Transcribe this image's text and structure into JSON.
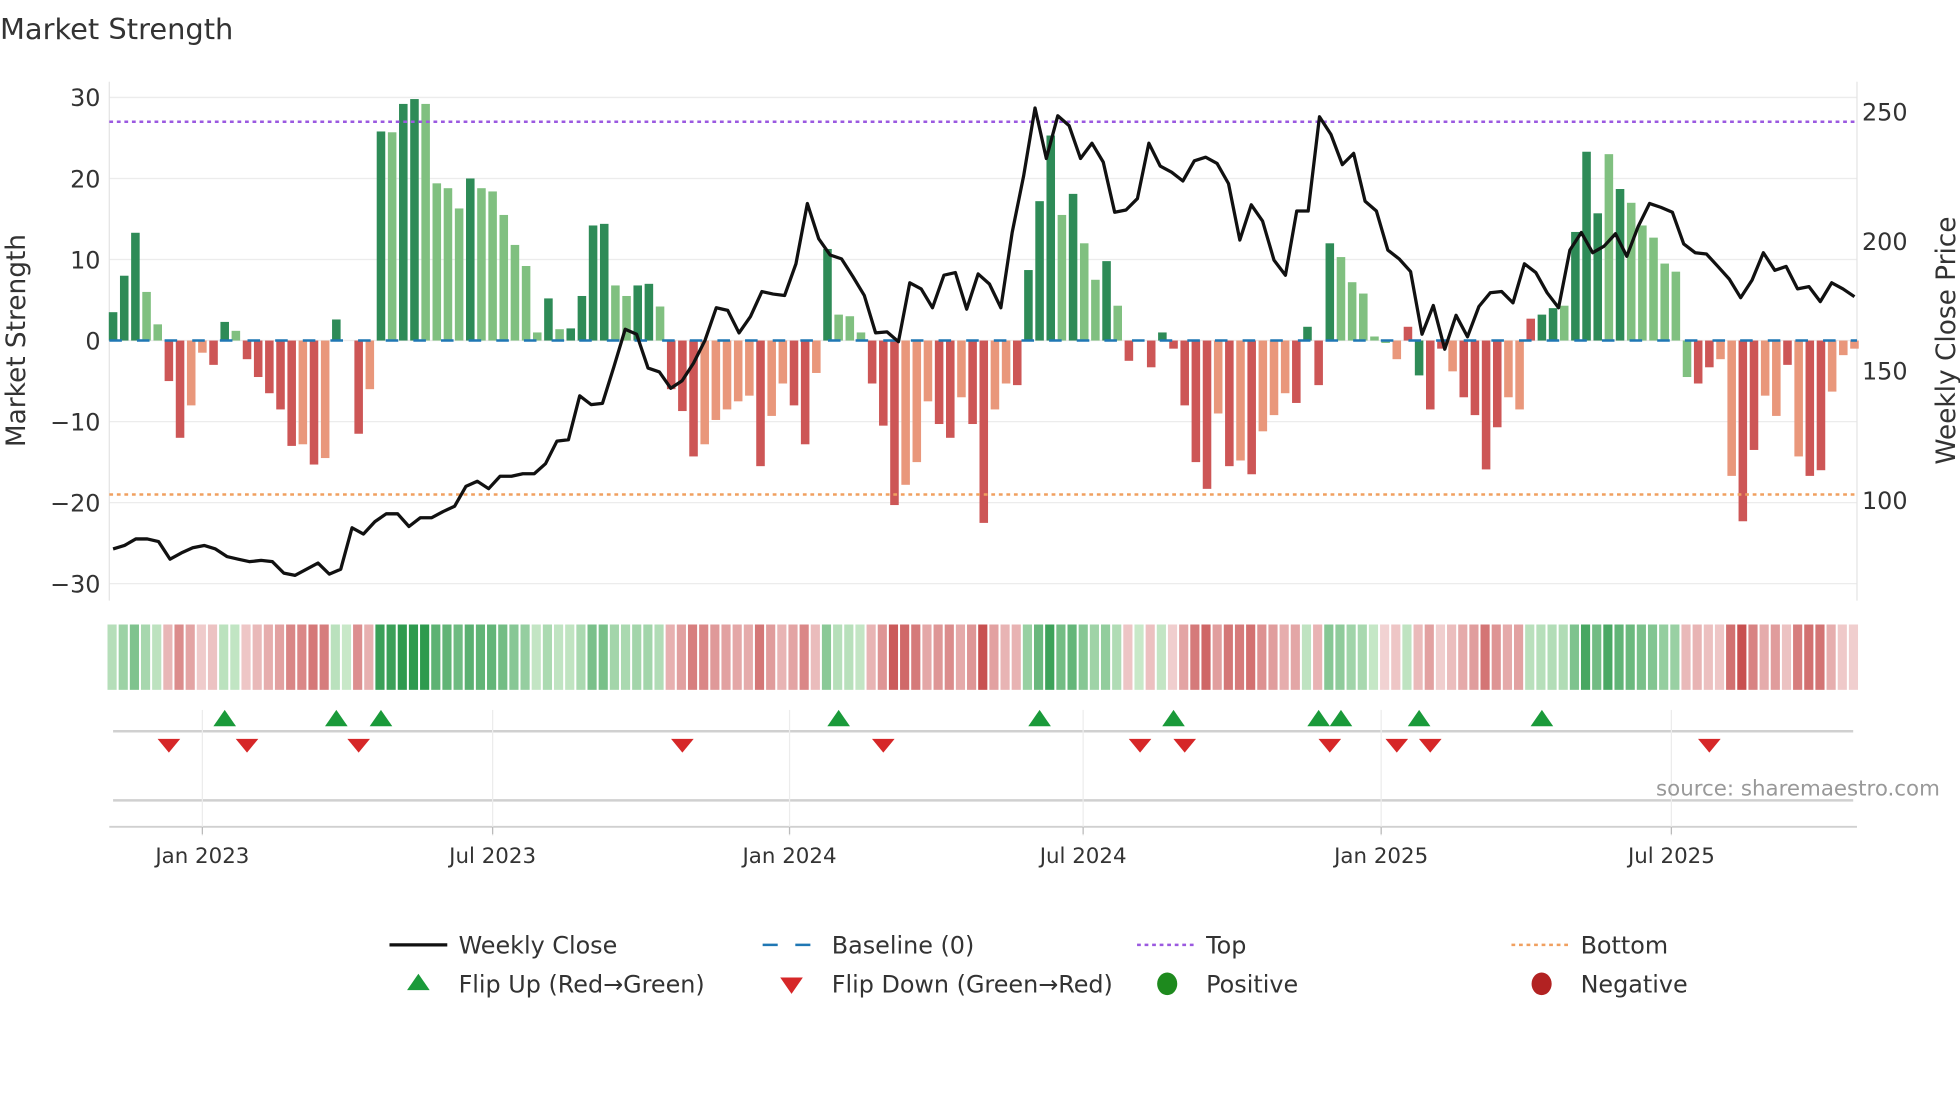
{
  "title": "Market Strength",
  "source": "source: sharemaestro.com",
  "chart_data": {
    "type": "bar",
    "title": "Market Strength",
    "ylabel": "Market Strength",
    "y2label": "Weekly Close Price",
    "ylim": [
      -32,
      32
    ],
    "y2lim": [
      65,
      260
    ],
    "yticks": [
      30,
      20,
      10,
      0,
      -10,
      -20,
      -30
    ],
    "ytick_labels": [
      "30",
      "20",
      "10",
      "0",
      "−10",
      "−20",
      "−30"
    ],
    "y2ticks": [
      250,
      200,
      150,
      100
    ],
    "y2tick_labels": [
      "250",
      "200",
      "150",
      "100"
    ],
    "x_unit": "week index",
    "xticks": [
      {
        "week": 8,
        "label": "Jan 2023"
      },
      {
        "week": 34,
        "label": "Jul 2023"
      },
      {
        "week": 60.6,
        "label": "Jan 2024"
      },
      {
        "week": 86.9,
        "label": "Jul 2024"
      },
      {
        "week": 113.6,
        "label": "Jan 2025"
      },
      {
        "week": 139.6,
        "label": "Jul 2025"
      }
    ],
    "top_level": 27,
    "bottom_level": -19,
    "baseline": 0,
    "strength": [
      3.5,
      8,
      13.3,
      6,
      2,
      -5,
      -12,
      -8,
      -1.5,
      -3,
      2.3,
      1.2,
      -2.3,
      -4.5,
      -6.5,
      -8.5,
      -13,
      -12.8,
      -15.3,
      -14.5,
      2.6,
      0,
      -11.5,
      -6,
      25.8,
      25.7,
      29.2,
      29.8,
      29.2,
      19.4,
      18.8,
      16.3,
      20,
      18.8,
      18.4,
      15.5,
      11.8,
      9.2,
      1,
      5.2,
      1.4,
      1.5,
      5.5,
      14.2,
      14.4,
      6.8,
      5.5,
      6.8,
      7,
      4.2,
      -6,
      -8.7,
      -14.3,
      -12.8,
      -9.8,
      -8.5,
      -7.5,
      -6.8,
      -15.5,
      -9.3,
      -5.3,
      -8,
      -12.8,
      -4,
      11.3,
      3.2,
      3,
      1,
      -5.3,
      -10.5,
      -20.3,
      -17.8,
      -15,
      -7.5,
      -10.3,
      -12,
      -7,
      -10.3,
      -22.5,
      -8.5,
      -5.3,
      -5.5,
      8.7,
      17.2,
      25.3,
      15.5,
      18.1,
      12,
      7.5,
      9.8,
      4.3,
      -2.5,
      0,
      -3.3,
      1,
      -1,
      -8,
      -15,
      -18.3,
      -9,
      -15.5,
      -14.8,
      -16.5,
      -11.2,
      -9.2,
      -6.5,
      -7.7,
      1.7,
      -5.5,
      12,
      10.3,
      7.2,
      5.8,
      0.5,
      -0.3,
      -2.3,
      1.7,
      -4.3,
      -8.5,
      -1,
      -3.8,
      -7,
      -9.2,
      -15.9,
      -10.7,
      -7,
      -8.5,
      2.7,
      3.2,
      4,
      4.3,
      13.4,
      23.3,
      15.7,
      23,
      18.7,
      17,
      14.2,
      12.7,
      9.5,
      8.5,
      -4.5,
      -5.3,
      -3.3,
      -2.3,
      -16.7,
      -22.3,
      -13.5,
      -6.8,
      -9.3,
      -3,
      -14.3,
      -16.7,
      -16,
      -6.3,
      -1.8,
      -1
    ],
    "shade": "GGGggRRrrRGgRRRRRrRrGGRrGgGGggggGggggggGgGGGGggGGgRRRrrrrrRrrRRrGgggRRRrrrRRrRRrrRGGGgGggGgRGRGRRRRrRrRrrrRGRGgggggrRGRRrRRRRrrRGGgGGGgGggggggRRrrRRrrRrRRrrrr",
    "weekly_close": [
      81.1,
      82.5,
      85,
      85,
      84,
      77.2,
      79.6,
      81.6,
      82.5,
      81.1,
      78.2,
      77.2,
      76.2,
      76.7,
      76.2,
      71.8,
      70.9,
      73.3,
      75.7,
      71.4,
      73.3,
      89.3,
      86.9,
      91.7,
      94.7,
      94.7,
      89.8,
      93.2,
      93.2,
      95.6,
      97.6,
      105.3,
      107.3,
      104.4,
      109.2,
      109.2,
      110.2,
      110.2,
      114.1,
      122.8,
      123.3,
      140.3,
      136.9,
      137.4,
      151.5,
      166,
      164.1,
      151,
      149.5,
      143.2,
      146.1,
      152.9,
      161.7,
      174.3,
      173.3,
      164.6,
      170.9,
      180.6,
      179.6,
      179.1,
      191.3,
      214.6,
      201,
      194.7,
      193.2,
      186.4,
      179.1,
      164.6,
      165,
      161.2,
      184,
      181.6,
      174.3,
      186.9,
      187.9,
      173.8,
      187.4,
      183.5,
      174.3,
      203.4,
      225.2,
      251.5,
      232,
      248.5,
      244.7,
      232,
      237.9,
      230.6,
      211.2,
      212.1,
      216.5,
      237.9,
      229.1,
      226.7,
      223.3,
      231.1,
      232.5,
      230.1,
      222.3,
      200.5,
      214.1,
      207.8,
      192.7,
      186.9,
      211.7,
      211.7,
      248.1,
      241.3,
      229.6,
      234,
      215.5,
      211.7,
      196.6,
      193.2,
      188.3,
      164.1,
      175.2,
      158.3,
      171.4,
      163.1,
      174.8,
      180.1,
      180.6,
      176.2,
      191.3,
      187.9,
      180.1,
      174.3,
      196.6,
      203.4,
      195.6,
      198.1,
      202.9,
      194.2,
      205.8,
      214.6,
      213.1,
      211.2,
      199,
      195.6,
      195.1,
      190.3,
      185.4,
      178.2,
      185,
      195.6,
      188.8,
      190.3,
      181.6,
      182.5,
      176.7,
      184,
      181.6,
      178.6
    ],
    "flip_up_weeks": [
      10,
      20,
      24,
      65,
      83,
      95,
      108,
      110,
      117,
      128
    ],
    "flip_down_weeks": [
      5,
      12,
      22,
      51,
      69,
      92,
      96,
      109,
      115,
      118,
      143
    ],
    "legend": {
      "placement": "bottom",
      "items": [
        {
          "label": "Weekly Close",
          "kind": "line"
        },
        {
          "label": "Baseline (0)",
          "kind": "dash"
        },
        {
          "label": "Top",
          "kind": "dot-purple"
        },
        {
          "label": "Bottom",
          "kind": "dot-orange"
        },
        {
          "label": "Flip Up (Red→Green)",
          "kind": "tri-up"
        },
        {
          "label": "Flip Down (Green→Red)",
          "kind": "tri-down"
        },
        {
          "label": "Positive",
          "kind": "circle-green"
        },
        {
          "label": "Negative",
          "kind": "circle-red"
        }
      ]
    }
  },
  "colors": {
    "strong_green": "#2e8b57",
    "soft_green": "#80c080",
    "strong_red": "#cd5656",
    "soft_red": "#e9977b",
    "line": "#111111",
    "baseline": "#1f77b4",
    "top": "#9b59e0",
    "bottom": "#f0a060",
    "flip_up": "#1a9a3a",
    "flip_down": "#d62728",
    "positive": "#1e8a1e",
    "negative": "#b22222"
  }
}
